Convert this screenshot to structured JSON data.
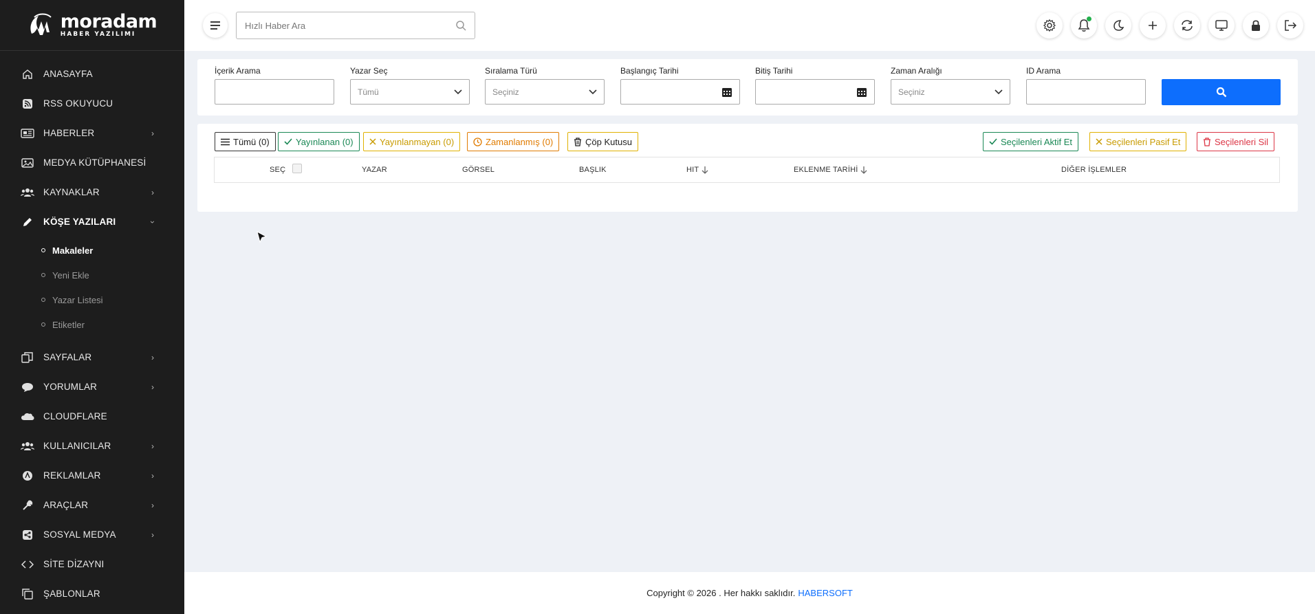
{
  "brand": {
    "name": "moradam",
    "tagline": "HABER YAZILIMI"
  },
  "sidebar": {
    "items": [
      {
        "label": "ANASAYFA",
        "icon": "home-icon",
        "chevron": false
      },
      {
        "label": "RSS OKUYUCU",
        "icon": "rss-icon",
        "chevron": false
      },
      {
        "label": "HABERLER",
        "icon": "newspaper-icon",
        "chevron": true
      },
      {
        "label": "MEDYA KÜTÜPHANESİ",
        "icon": "image-icon",
        "chevron": false
      },
      {
        "label": "KAYNAKLAR",
        "icon": "users-icon",
        "chevron": true
      },
      {
        "label": "KÖŞE YAZILARI",
        "icon": "pencil-icon",
        "chevron": true,
        "expanded": true
      },
      {
        "label": "SAYFALAR",
        "icon": "pages-icon",
        "chevron": true
      },
      {
        "label": "YORUMLAR",
        "icon": "comment-icon",
        "chevron": true
      },
      {
        "label": "CLOUDFLARE",
        "icon": "cloud-icon",
        "chevron": false
      },
      {
        "label": "KULLANICILAR",
        "icon": "users-icon",
        "chevron": true
      },
      {
        "label": "REKLAMLAR",
        "icon": "ad-icon",
        "chevron": true
      },
      {
        "label": "ARAÇLAR",
        "icon": "wrench-icon",
        "chevron": true
      },
      {
        "label": "SOSYAL MEDYA",
        "icon": "share-icon",
        "chevron": true
      },
      {
        "label": "SİTE DİZAYNI",
        "icon": "design-icon",
        "chevron": false
      },
      {
        "label": "ŞABLONLAR",
        "icon": "copy-icon",
        "chevron": false
      }
    ],
    "submenu": [
      {
        "label": "Makaleler",
        "active": true
      },
      {
        "label": "Yeni Ekle",
        "active": false
      },
      {
        "label": "Yazar Listesi",
        "active": false
      },
      {
        "label": "Etiketler",
        "active": false
      }
    ]
  },
  "header": {
    "search_placeholder": "Hızlı Haber Ara",
    "icons": [
      "gear-icon",
      "bell-icon",
      "moon-icon",
      "plus-icon",
      "refresh-icon",
      "monitor-icon",
      "lock-icon",
      "logout-icon"
    ]
  },
  "filters": {
    "content_search": {
      "label": "İçerik Arama",
      "value": ""
    },
    "author": {
      "label": "Yazar Seç",
      "value": "Tümü"
    },
    "sort": {
      "label": "Sıralama Türü",
      "value": "Seçiniz"
    },
    "start_date": {
      "label": "Başlangıç Tarihi",
      "value": ""
    },
    "end_date": {
      "label": "Bitiş Tarihi",
      "value": ""
    },
    "time_range": {
      "label": "Zaman Aralığı",
      "value": "Seçiniz"
    },
    "id_search": {
      "label": "ID Arama",
      "value": ""
    }
  },
  "status_filters": {
    "all": "Tümü (0)",
    "published": "Yayınlanan (0)",
    "unpublished": "Yayınlanmayan (0)",
    "scheduled": "Zamanlanmış (0)",
    "trash": "Çöp Kutusu"
  },
  "bulk_actions": {
    "activate": "Seçilenleri Aktif Et",
    "deactivate": "Seçilenleri Pasif Et",
    "delete": "Seçilenleri Sil"
  },
  "table": {
    "columns": {
      "select": "SEÇ",
      "author": "YAZAR",
      "image": "GÖRSEL",
      "title": "BAŞLIK",
      "hit": "HIT",
      "date": "EKLENME TARİHİ",
      "actions": "DİĞER İŞLEMLER"
    }
  },
  "footer": {
    "text": "Copyright © 2026 . Her hakkı saklıdır.",
    "brand": "HABERSOFT"
  },
  "colors": {
    "sidebar_bg": "#1d1d1d",
    "primary": "#0d6efd",
    "success": "#198754",
    "warning": "#d4a20a",
    "orange": "#e07b00",
    "danger": "#dc3545"
  }
}
